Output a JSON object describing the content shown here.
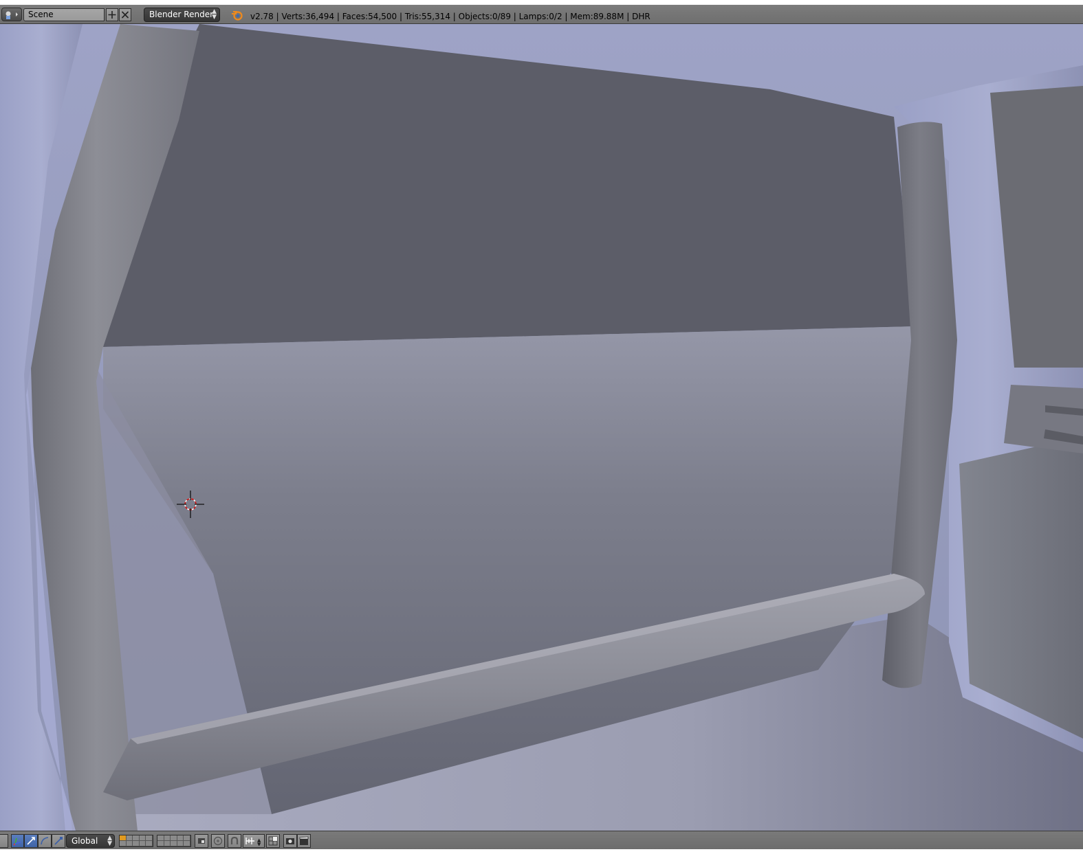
{
  "info_header": {
    "editor_type_icon": "info-editor-icon",
    "scene_name": "Scene",
    "add_scene_icon": "plus-icon",
    "delete_scene_icon": "x-icon",
    "render_engine": "Blender Render",
    "logo_icon": "blender-logo-icon",
    "stats": "v2.78 | Verts:36,494 | Faces:54,500 | Tris:55,314 | Objects:0/89 | Lamps:0/2 | Mem:89.88M | DHR"
  },
  "viewport": {
    "cursor_icon": "3d-cursor-icon",
    "scene_description_colors": {
      "wall_dark": "#5c5d68",
      "wall_mid": "#7a7c8c",
      "frame_light": "#9da3c4",
      "floor": "#a2a4b8"
    }
  },
  "view3d_header": {
    "manipulator_icons": [
      "manipulator-toggle-icon",
      "translate-icon",
      "rotate-icon",
      "scale-icon"
    ],
    "transform_orientation": "Global",
    "layer_icons": [
      "layers-group-1",
      "layers-group-2"
    ],
    "icons": [
      "lock-camera-icon",
      "proportional-edit-icon",
      "snap-icon",
      "snap-element-icon",
      "opengl-render-icon",
      "opengl-animation-icon"
    ]
  }
}
